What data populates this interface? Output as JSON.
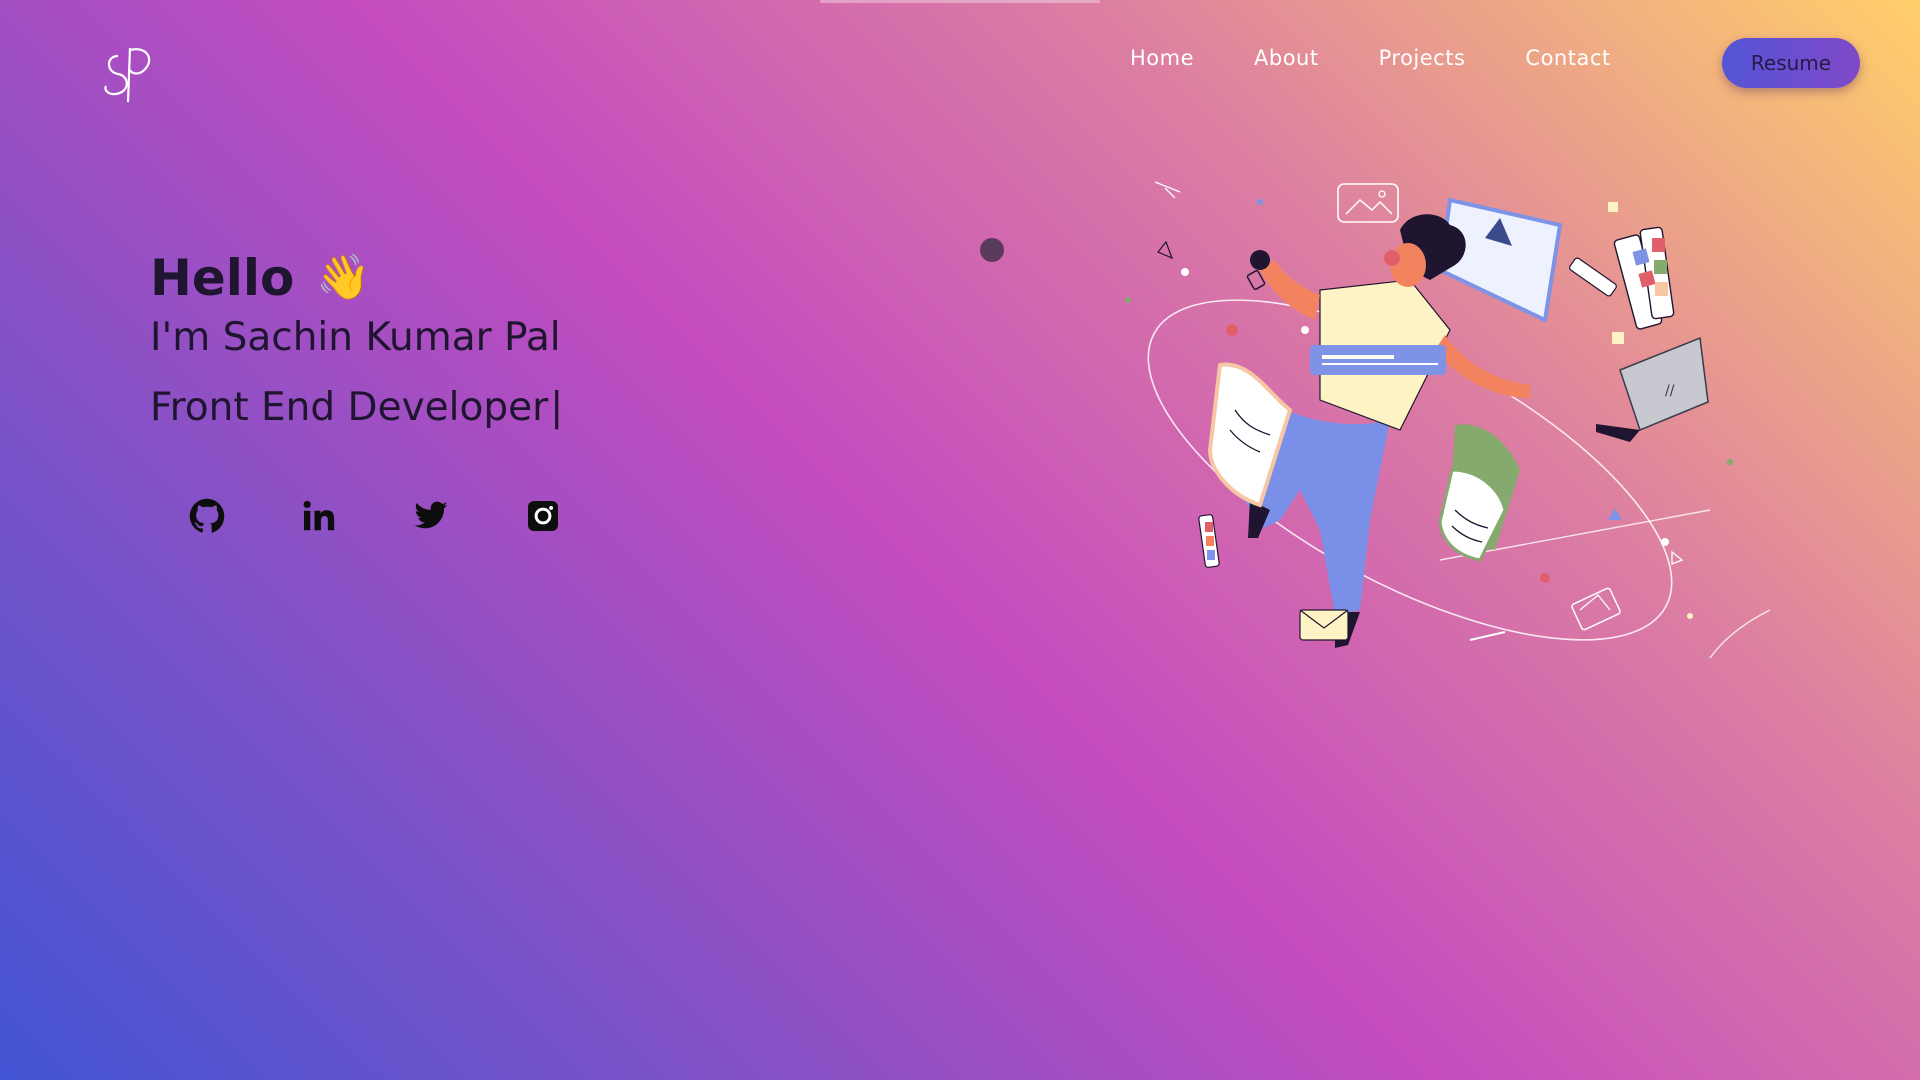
{
  "brand": {
    "logo_text": "SP"
  },
  "nav": {
    "items": [
      {
        "label": "Home"
      },
      {
        "label": "About"
      },
      {
        "label": "Projects"
      },
      {
        "label": "Contact"
      }
    ],
    "resume_label": "Resume"
  },
  "hero": {
    "greeting": "Hello",
    "wave": "👋",
    "name_line": "I'm Sachin Kumar Pal",
    "role_line": "Front End Developer",
    "cursor": "|"
  },
  "socials": [
    {
      "icon": "github-icon"
    },
    {
      "icon": "linkedin-icon"
    },
    {
      "icon": "twitter-icon"
    },
    {
      "icon": "instagram-icon"
    }
  ],
  "illustration_text": "//",
  "colors": {
    "gradient_start": "#4255d4",
    "gradient_mid": "#c44cbf",
    "gradient_end": "#ffcf6a",
    "text_dark": "#1f1530",
    "button_start": "#5455d6",
    "button_end": "#7f49c8"
  }
}
